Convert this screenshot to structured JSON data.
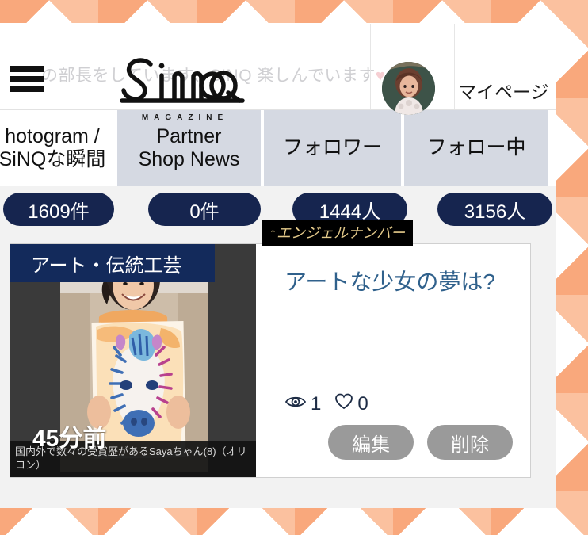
{
  "header": {
    "menu_icon": "hamburger-menu-icon",
    "background_text": "の部長をしています、SINQ 楽しんでいます",
    "background_heart": "♥",
    "logo_text": "Sinq",
    "logo_subtitle": "MAGAZINE",
    "avatar_name": "user-avatar",
    "mypage_label": "マイページ"
  },
  "tabs": [
    {
      "label_line1": "hotogram /",
      "label_line2": "SiNQな瞬間",
      "active": true
    },
    {
      "label_line1": "Partner",
      "label_line2": "Shop News",
      "active": false
    },
    {
      "label_line1": "フォロワー",
      "label_line2": "",
      "active": false
    },
    {
      "label_line1": "フォロー中",
      "label_line2": "",
      "active": false
    }
  ],
  "counts": [
    {
      "value": "1609件"
    },
    {
      "value": "0件"
    },
    {
      "value": "1444人"
    },
    {
      "value": "3156人"
    }
  ],
  "tooltip": {
    "text": "↑エンジェルナンバー",
    "background": "#000000",
    "color": "#e3c98a"
  },
  "post": {
    "category": "アート・伝統工芸",
    "title": "アートな少女の夢は?",
    "time_ago": "45分前",
    "caption": "国内外で数々の受賞歴があるSayaちゃん(8)（オリコン）",
    "views_icon": "eye-icon",
    "views": "1",
    "likes_icon": "heart-icon",
    "likes": "0",
    "edit_label": "編集",
    "delete_label": "削除"
  },
  "colors": {
    "badge_navy": "#16254f",
    "category_navy": "#132a5b",
    "title_blue": "#30618c",
    "tab_inactive": "#d5d9e2",
    "action_gray": "#9a9a9a",
    "pattern_orange": "#f9a87c",
    "pattern_peach": "#fbc19f"
  }
}
